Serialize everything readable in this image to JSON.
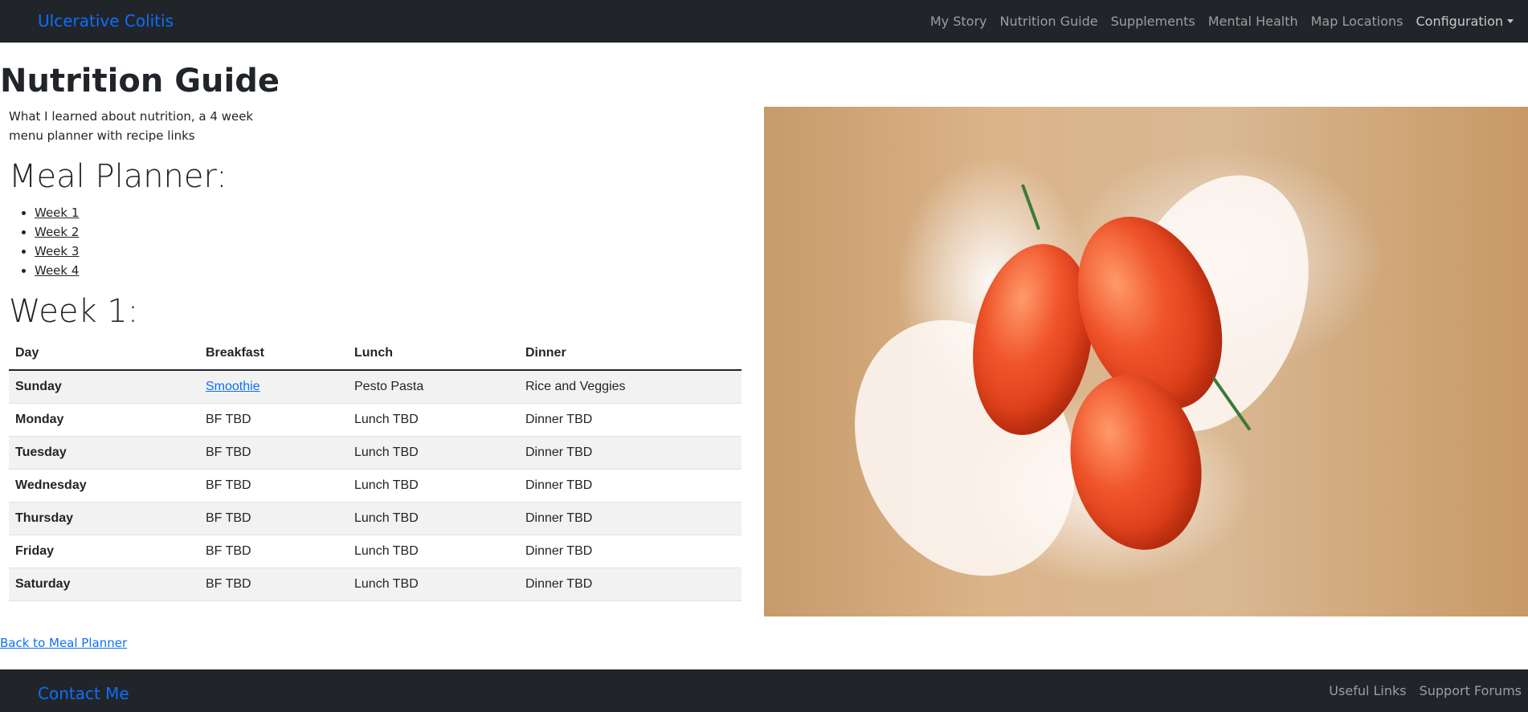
{
  "navbar": {
    "brand": "Ulcerative Colitis",
    "links": [
      "My Story",
      "Nutrition Guide",
      "Supplements",
      "Mental Health",
      "Map Locations"
    ],
    "dropdown": "Configuration"
  },
  "page": {
    "title": "Nutrition Guide",
    "intro": "What I learned about nutrition, a 4 week menu planner with recipe links",
    "meal_planner_heading": "Meal Planner:",
    "weeks": [
      "Week 1",
      "Week 2",
      "Week 3",
      "Week 4"
    ],
    "week_heading": "Week 1:"
  },
  "table": {
    "headers": [
      "Day",
      "Breakfast",
      "Lunch",
      "Dinner"
    ],
    "rows": [
      [
        "Sunday",
        "Smoothie",
        "Pesto Pasta",
        "Rice and Veggies"
      ],
      [
        "Monday",
        "BF TBD",
        "Lunch TBD",
        "Dinner TBD"
      ],
      [
        "Tuesday",
        "BF TBD",
        "Lunch TBD",
        "Dinner TBD"
      ],
      [
        "Wednesday",
        "BF TBD",
        "Lunch TBD",
        "Dinner TBD"
      ],
      [
        "Thursday",
        "BF TBD",
        "Lunch TBD",
        "Dinner TBD"
      ],
      [
        "Friday",
        "BF TBD",
        "Lunch TBD",
        "Dinner TBD"
      ],
      [
        "Saturday",
        "BF TBD",
        "Lunch TBD",
        "Dinner TBD"
      ]
    ]
  },
  "back_link": "Back to Meal Planner",
  "footer": {
    "brand": "Contact Me",
    "links": [
      "Useful Links",
      "Support Forums"
    ]
  },
  "colors": {
    "navbar_bg": "#212529",
    "brand": "#0d6efd",
    "striped_row": "#f2f2f2"
  }
}
